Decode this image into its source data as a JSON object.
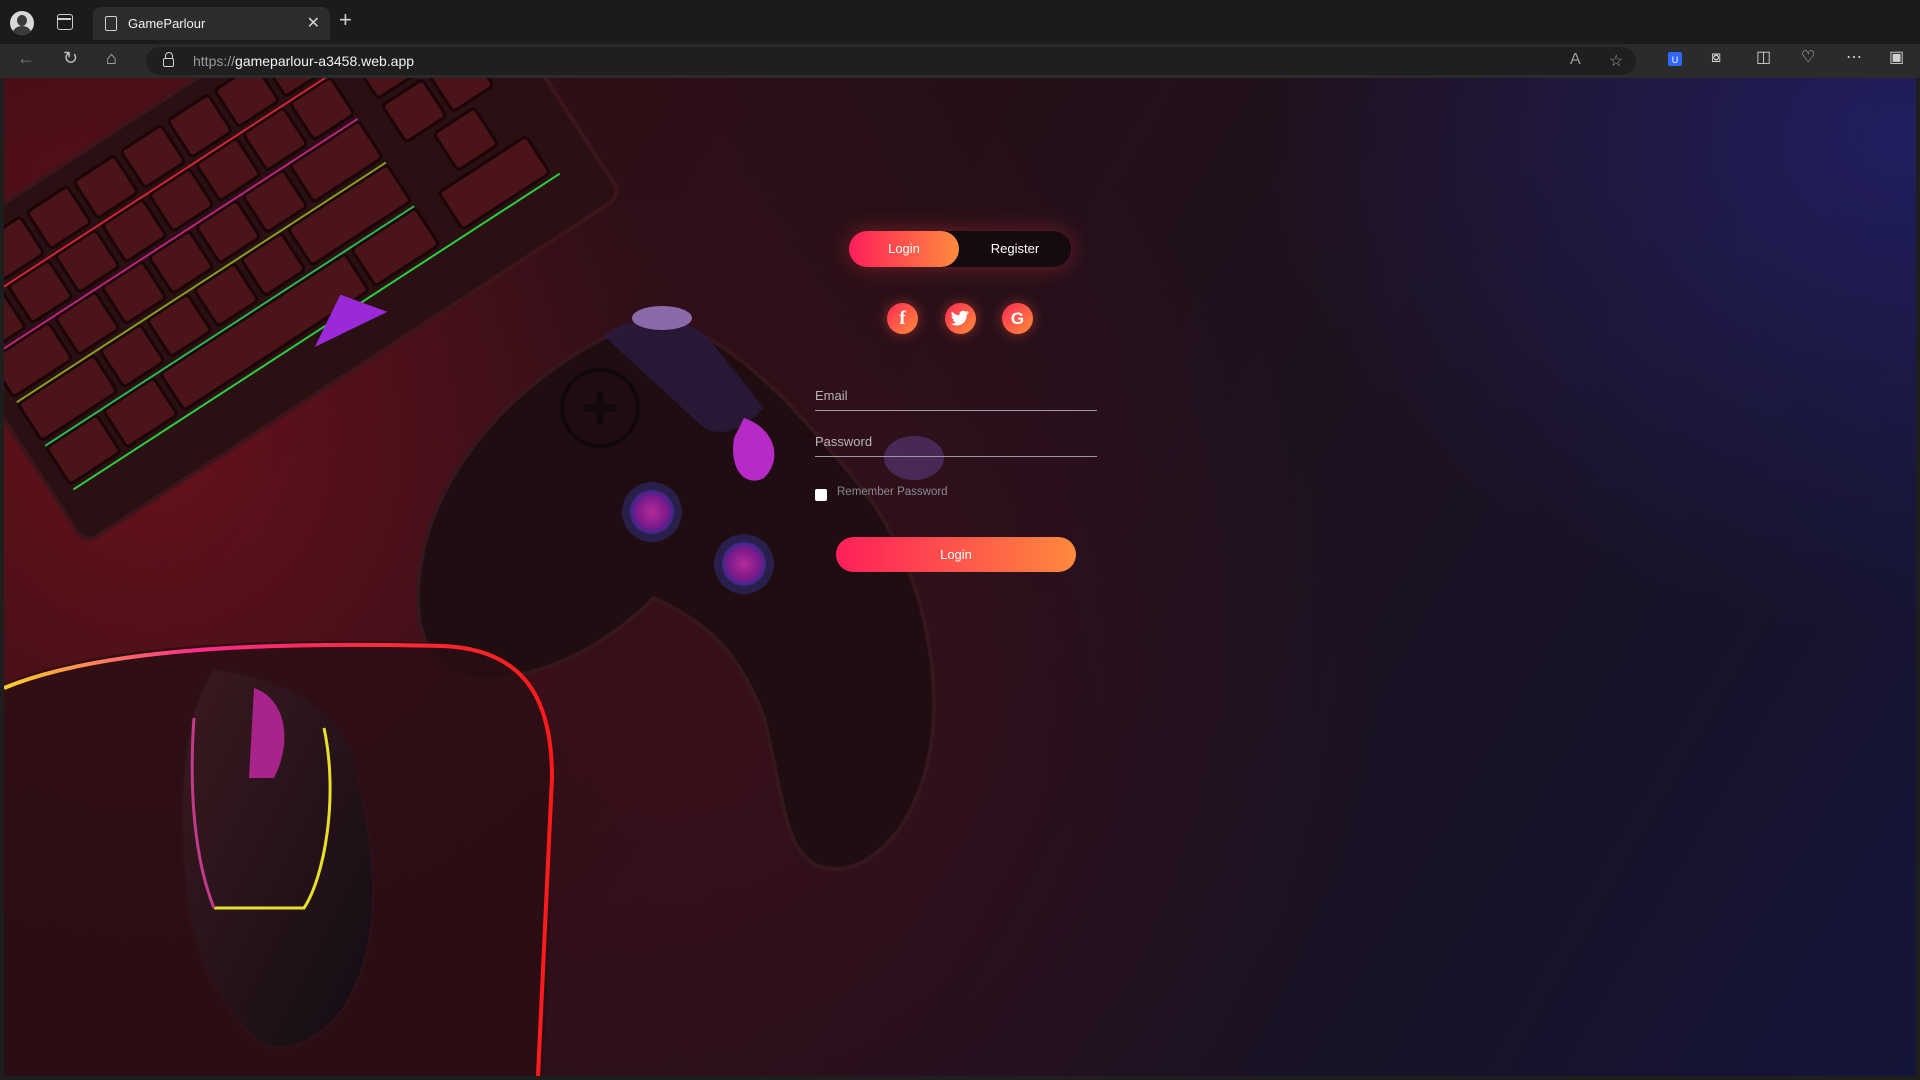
{
  "browser": {
    "tab_title": "GameParlour",
    "tab_close": "✕",
    "new_tab": "+",
    "url_protocol": "https://",
    "url_host": "gameparlour-a3458.web.app"
  },
  "auth": {
    "switch": {
      "login_label": "Login",
      "register_label": "Register"
    },
    "social": {
      "facebook": "f",
      "twitter": "twitter-bird-icon",
      "google": "G"
    },
    "email_placeholder": "Email",
    "password_placeholder": "Password",
    "remember_label": "Remember Password",
    "submit_label": "Login"
  },
  "colors": {
    "accent_start": "#ff1f5a",
    "accent_end": "#ff8a3d",
    "background_dark": "#171328"
  }
}
